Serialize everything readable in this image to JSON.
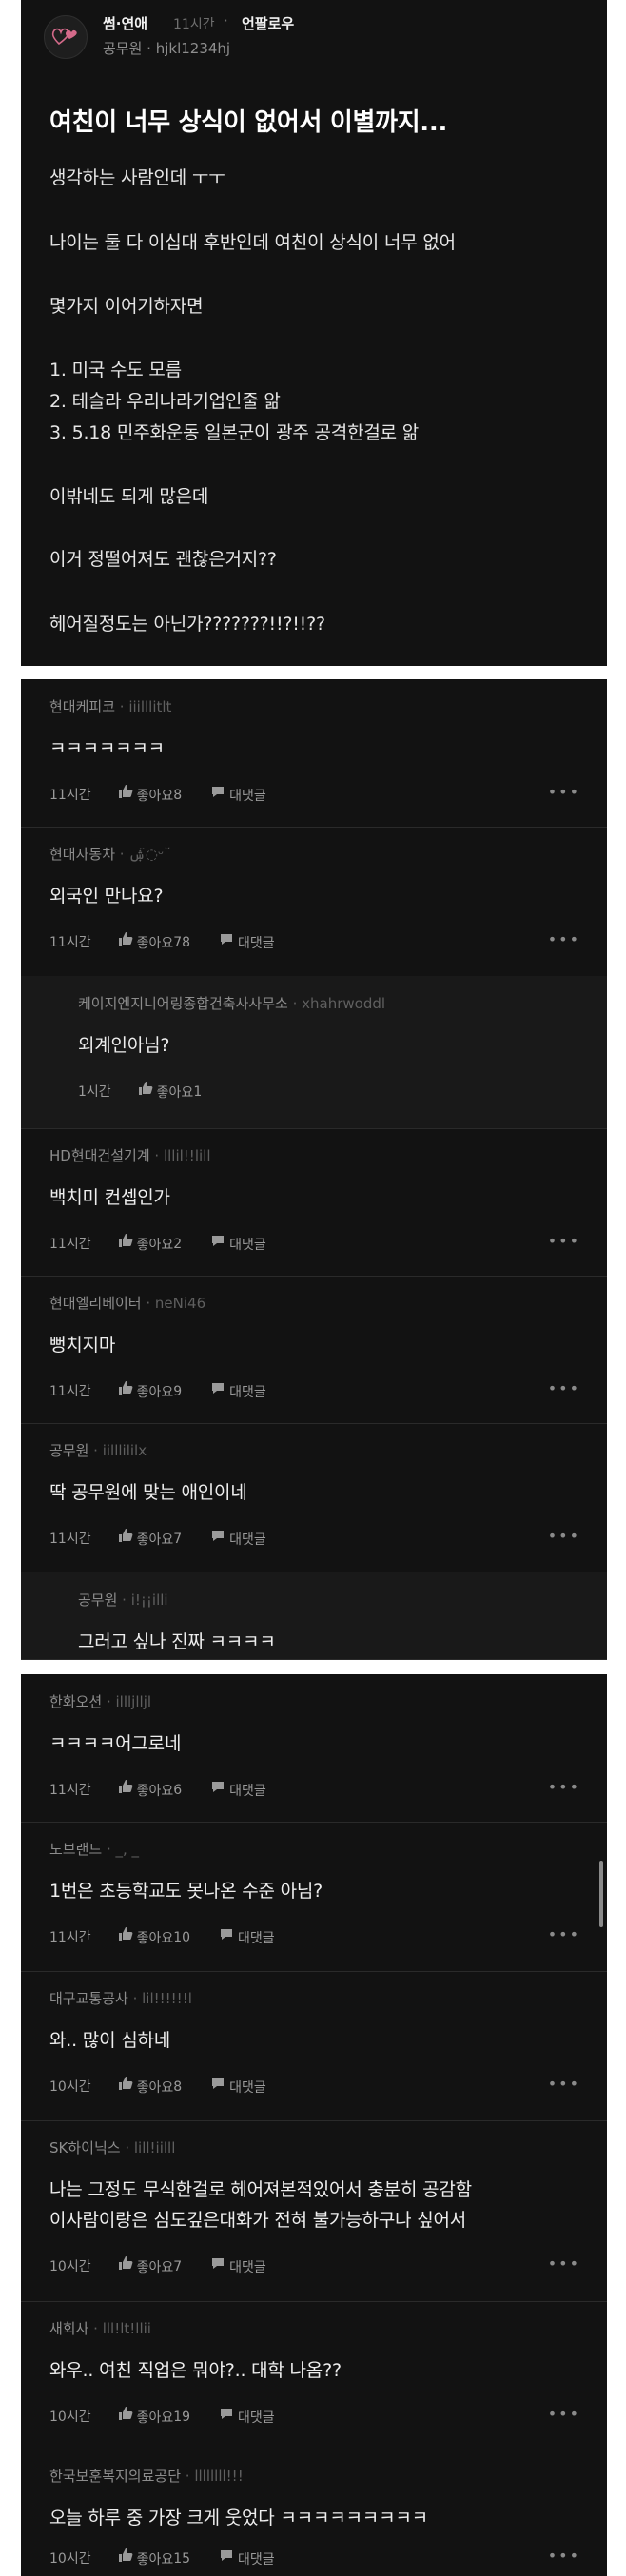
{
  "post": {
    "board": "썸·연애",
    "time": "11시간",
    "dot": "·",
    "follow_label": "언팔로우",
    "author": "공무원 · hjkl1234hj",
    "title": "여친이 너무 상식이 없어서 이별까지...",
    "lines": [
      "생각하는 사람인데 ㅜㅜ",
      "나이는 둘 다 이십대 후반인데 여친이 상식이 너무 없어",
      "몇가지 이어기하자면",
      "1. 미국 수도 모름",
      "2. 테슬라 우리나라기업인줄 앎",
      "3. 5.18 민주화운동  일본군이 광주 공격한걸로 앎",
      "이밖네도 되게 많은데",
      "이거 정떨어져도 괜찮은거지??",
      "헤어질정도는 아닌가???????!!?!!??"
    ]
  },
  "labels": {
    "like": "좋아요",
    "reply": "대댓글",
    "more": "•••"
  },
  "comments": [
    {
      "company": "현대케피코",
      "handle": "iiilllitlt",
      "text": "ㅋㅋㅋㅋㅋㅋㅋ",
      "time": "11시간",
      "likes": "8",
      "reply": true
    },
    {
      "company": "현대자동차",
      "handle": "ۺ◌̈ᵕ˘",
      "text": "외국인 만나요?",
      "time": "11시간",
      "likes": "78",
      "reply": true
    },
    {
      "company": "케이지엔지니어링종합건축사사무소",
      "handle": "xhahrwoddl",
      "text": "외계인아님?",
      "time": "1시간",
      "likes": "1",
      "reply": false
    },
    {
      "company": "HD현대건설기계",
      "handle": "lllil!!lill",
      "text": "백치미 컨셉인가",
      "time": "11시간",
      "likes": "2",
      "reply": true
    },
    {
      "company": "현대엘리베이터",
      "handle": "neNi46",
      "text": "뻥치지마",
      "time": "11시간",
      "likes": "9",
      "reply": true
    },
    {
      "company": "공무원",
      "handle": "iilllililx",
      "text": "딱 공무원에 맞는 애인이네",
      "time": "11시간",
      "likes": "7",
      "reply": true
    },
    {
      "company": "공무원",
      "handle": "i!¡¡illi",
      "text": "그러고 싶나 진짜 ㅋㅋㅋㅋ",
      "time": "",
      "likes": "",
      "reply": false
    },
    {
      "company": "한화오션",
      "handle": "illljlljl",
      "text": "ㅋㅋㅋㅋ어그로네",
      "time": "11시간",
      "likes": "6",
      "reply": true
    },
    {
      "company": "노브랜드",
      "handle": "_, _",
      "text": "1번은 초등학교도 못나온 수준 아님?",
      "time": "11시간",
      "likes": "10",
      "reply": true
    },
    {
      "company": "대구교통공사",
      "handle": "lil!!!!!!l",
      "text": "와.. 많이 심하네",
      "time": "10시간",
      "likes": "8",
      "reply": true
    },
    {
      "company": "SK하이닉스",
      "handle": "lill!iilll",
      "text": "나는 그정도 무식한걸로 헤어져본적있어서 충분히 공감함",
      "text2": "이사람이랑은 심도깊은대화가 전혀 불가능하구나 싶어서",
      "time": "10시간",
      "likes": "7",
      "reply": true
    },
    {
      "company": "새회사",
      "handle": "lll!lt!llii",
      "text": "와우.. 여친 직업은 뭐야?.. 대학 나옴??",
      "time": "10시간",
      "likes": "19",
      "reply": true
    },
    {
      "company": "한국보훈복지의료공단",
      "handle": "llllllll!!!",
      "text": "오늘 하루 중 가장 크게 웃었다 ㅋㅋㅋㅋㅋㅋㅋㅋㅋ",
      "time": "10시간",
      "likes": "15",
      "reply": true
    }
  ]
}
